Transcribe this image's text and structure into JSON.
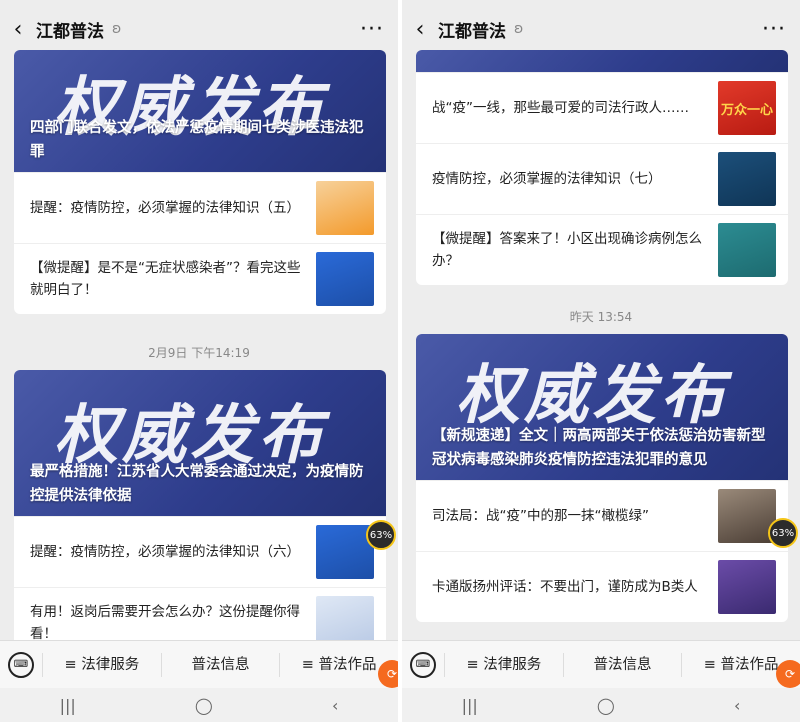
{
  "header": {
    "title": "江都普法",
    "back_icon": "chevron-left-icon",
    "more_icon": "more-icon"
  },
  "left": {
    "card1": {
      "banner_art": "权威发布",
      "banner_title": "四部门联合发文，依法严惩疫情期间七类涉医违法犯罪",
      "items": [
        {
          "text": "提醒：疫情防控，必须掌握的法律知识（五）"
        },
        {
          "text": "【微提醒】是不是“无症状感染者”？看完这些就明白了！"
        }
      ]
    },
    "timestamp": "2月9日 下午14:19",
    "card2": {
      "banner_art": "权威发布",
      "banner_title": "最严格措施！江苏省人大常委会通过决定，为疫情防控提供法律依据",
      "items": [
        {
          "text": "提醒：疫情防控，必须掌握的法律知识（六）"
        },
        {
          "text": "有用！返岗后需要开会怎么办？这份提醒你得看！"
        }
      ]
    },
    "badge": "63%"
  },
  "right": {
    "card1": {
      "items": [
        {
          "text": "战“疫”一线，那些最可爱的司法行政人……",
          "thumb_text": "万众一心"
        },
        {
          "text": "疫情防控，必须掌握的法律知识（七）"
        },
        {
          "text": "【微提醒】答案来了！小区出现确诊病例怎么办？"
        }
      ]
    },
    "timestamp": "昨天 13:54",
    "card2": {
      "banner_art": "权威发布",
      "banner_title": "【新规速递】全文｜两高两部关于依法惩治妨害新型冠状病毒感染肺炎疫情防控违法犯罪的意见",
      "items": [
        {
          "text": "司法局：战“疫”中的那一抹“橄榄绿”"
        },
        {
          "text": "卡通版扬州评话：不要出门，谨防成为B类人"
        }
      ]
    },
    "badge": "63%"
  },
  "menu": {
    "items": [
      "≡ 法律服务",
      "普法信息",
      "≡ 普法作品"
    ]
  }
}
